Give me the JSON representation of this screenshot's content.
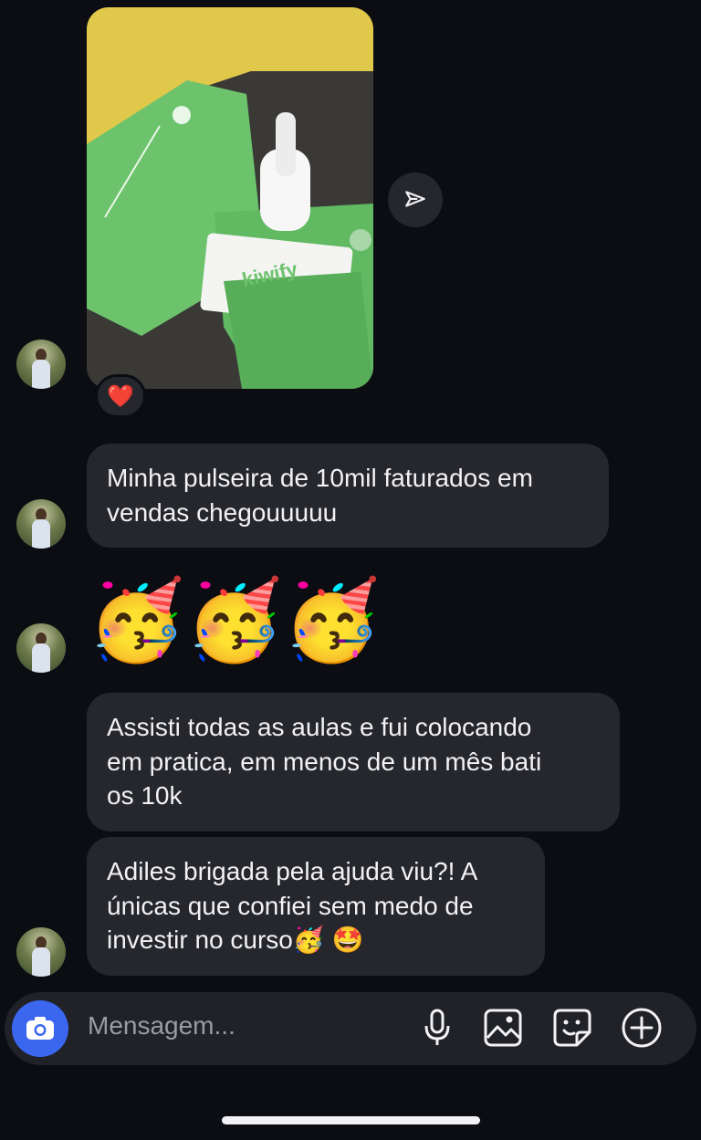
{
  "messages": [
    {
      "type": "image",
      "reaction": "❤️"
    },
    {
      "type": "text",
      "text": "Minha pulseira de 10mil faturados em\nvendas chegouuuuu"
    },
    {
      "type": "emoji",
      "text": "🥳🥳🥳"
    },
    {
      "type": "text",
      "text": "Assisti todas as aulas e fui colocando\nem pratica, em menos de um mês bati\nos 10k"
    },
    {
      "type": "text",
      "text": "Adiles brigada pela ajuda viu?! A\núnicas que confiei sem medo de\ninvestir no curso🥳 🤩"
    }
  ],
  "photo": {
    "brand_text": "kiwify",
    "colors": {
      "card": "#6cc36c",
      "background": "#e0c84a"
    }
  },
  "composer": {
    "placeholder": "Mensagem..."
  },
  "icons": {
    "camera": "camera-icon",
    "mic": "microphone-icon",
    "gallery": "gallery-icon",
    "sticker": "sticker-icon",
    "plus": "plus-circle-icon",
    "send": "send-icon"
  },
  "colors": {
    "background": "#0b0d12",
    "bubble": "#25272d",
    "camera_button": "#3b66f0",
    "heart": "#e2263b"
  }
}
